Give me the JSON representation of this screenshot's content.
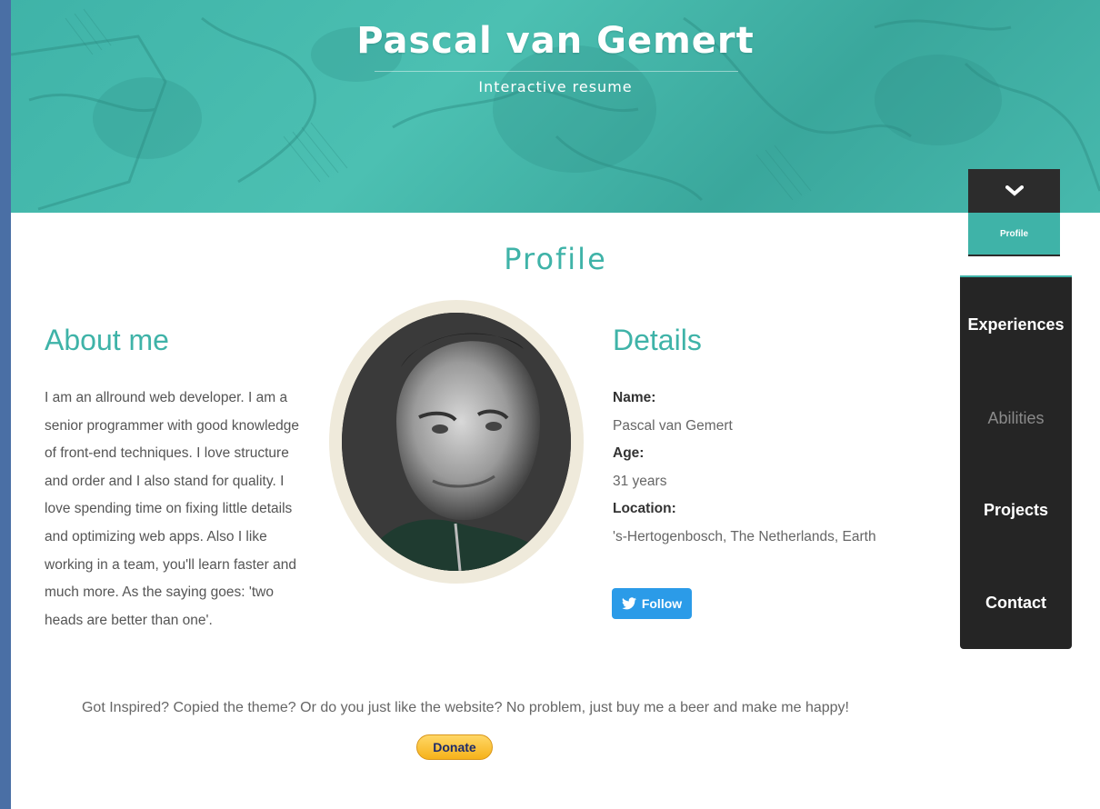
{
  "header": {
    "title": "Pascal van Gemert",
    "subtitle": "Interactive resume"
  },
  "section": {
    "title": "Profile"
  },
  "about": {
    "heading": "About me",
    "text": "I am an allround web developer. I am a senior programmer with good knowledge of front-end techniques. I love structure and order and I also stand for quality. I love spending time on fixing little details and optimizing web apps. Also I like working in a team, you'll learn faster and much more. As the saying goes: 'two heads are better than one'."
  },
  "details": {
    "heading": "Details",
    "name_label": "Name:",
    "name_value": "Pascal van Gemert",
    "age_label": "Age:",
    "age_value": "31 years",
    "location_label": "Location:",
    "location_value": "'s-Hertogenbosch, The Netherlands, Earth",
    "follow_label": "Follow"
  },
  "nav": {
    "current": "Profile",
    "items": [
      {
        "label": "Experiences",
        "active": true
      },
      {
        "label": "Abilities",
        "active": false
      },
      {
        "label": "Projects",
        "active": true
      },
      {
        "label": "Contact",
        "active": true
      }
    ]
  },
  "footer": {
    "text": "Got Inspired? Copied the theme? Or do you just like the website? No problem, just buy me a beer and make me happy!",
    "donate_label": "Donate"
  },
  "colors": {
    "accent": "#3fb3a8",
    "nav_bg": "#252525",
    "twitter": "#2b9be8",
    "donate": "#f6b21a"
  }
}
